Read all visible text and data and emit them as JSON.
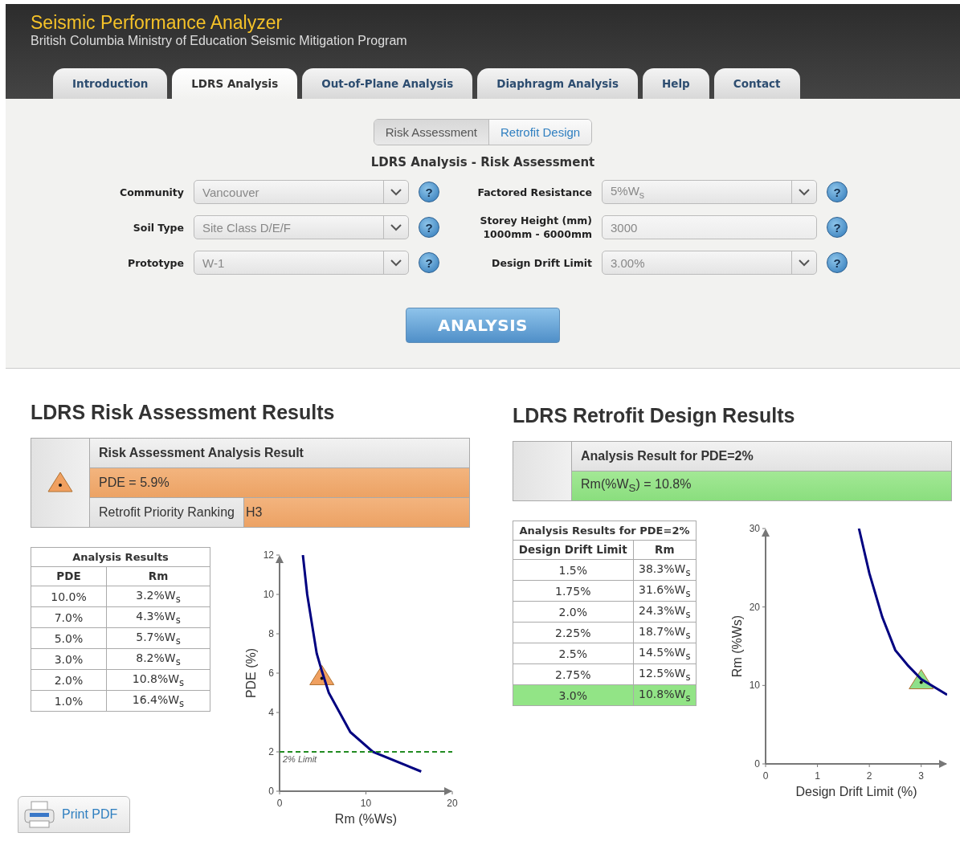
{
  "header": {
    "title": "Seismic Performance Analyzer",
    "subtitle": "British Columbia Ministry of Education Seismic Mitigation Program"
  },
  "tabs": [
    {
      "label": "Introduction",
      "selected": false
    },
    {
      "label": "LDRS Analysis",
      "selected": true
    },
    {
      "label": "Out-of-Plane Analysis",
      "selected": false
    },
    {
      "label": "Diaphragm Analysis",
      "selected": false
    },
    {
      "label": "Help",
      "selected": false
    },
    {
      "label": "Contact",
      "selected": false
    }
  ],
  "mode_toggle": [
    {
      "label": "Risk Assessment",
      "selected": true
    },
    {
      "label": "Retrofit Design",
      "selected": false
    }
  ],
  "form": {
    "title": "LDRS Analysis - Risk Assessment",
    "left_fields": [
      {
        "label": "Community",
        "kind": "select",
        "value": "Vancouver",
        "help": "?"
      },
      {
        "label": "Soil Type",
        "kind": "select",
        "value": "Site Class D/E/F",
        "help": "?"
      },
      {
        "label": "Prototype",
        "kind": "select",
        "value": "W-1",
        "help": "?"
      }
    ],
    "right_fields": [
      {
        "label": "Factored Resistance",
        "kind": "select",
        "value": "5%W$_{s}$",
        "help": "?"
      },
      {
        "label": "Storey Height (mm)",
        "hint": "1000mm - 6000mm",
        "kind": "input",
        "value": "3000",
        "help": "?"
      },
      {
        "label": "Design Drift Limit",
        "kind": "select",
        "value": "3.00%",
        "help": "?"
      }
    ],
    "submit": "ANALYSIS"
  },
  "risk_results": {
    "title": "LDRS Risk Assessment Results",
    "passed": false,
    "heading": "Risk Assessment Analysis Result",
    "result": "PDE = 5.9%",
    "ranking_label": "Retrofit Priority Ranking",
    "ranking_value": "H3",
    "table": {
      "caption": "Analysis Results",
      "columns": [
        "PDE",
        "Rm"
      ],
      "rows": [
        {
          "cells": [
            "10.0%",
            "3.2%W$_{s}$"
          ],
          "selected": false
        },
        {
          "cells": [
            "7.0%",
            "4.3%W$_{s}$"
          ],
          "selected": false
        },
        {
          "cells": [
            "5.0%",
            "5.7%W$_{s}$"
          ],
          "selected": false
        },
        {
          "cells": [
            "3.0%",
            "8.2%W$_{s}$"
          ],
          "selected": false
        },
        {
          "cells": [
            "2.0%",
            "10.8%W$_{s}$"
          ],
          "selected": false
        },
        {
          "cells": [
            "1.0%",
            "16.4%W$_{s}$"
          ],
          "selected": false
        }
      ]
    },
    "chart_data": {
      "type": "line",
      "xlabel": "Rm (%Ws)",
      "ylabel": "PDE (%)",
      "xlim": [
        0,
        20
      ],
      "ylim": [
        0,
        12
      ],
      "xticks": [
        0,
        10,
        20
      ],
      "yticks": [
        0,
        2,
        4,
        6,
        8,
        10,
        12
      ],
      "x": [
        0,
        2.7,
        3.2,
        4.3,
        4.9,
        5.7,
        8.2,
        10.8,
        16.4,
        20
      ],
      "series": [
        {
          "color": "#000080",
          "values": [
            null,
            12,
            10,
            7,
            6.1,
            5,
            3,
            2,
            1,
            null
          ]
        },
        {
          "color": "#f0a060",
          "marker": "triangle",
          "values": [
            null,
            null,
            null,
            null,
            5.9,
            null,
            null,
            null,
            null,
            null
          ]
        },
        {
          "name": "2% Limit",
          "color": "#228b22",
          "line_style": "dashed",
          "values": [
            2,
            null,
            null,
            null,
            null,
            null,
            null,
            null,
            null,
            2
          ]
        }
      ]
    }
  },
  "retrofit_results": {
    "title": "LDRS Retrofit Design Results",
    "passed": true,
    "heading": "Analysis Result for PDE=2%",
    "result": "Rm(%W$_{S}$) = 10.8%",
    "table": {
      "caption": "Analysis Results for PDE=2%",
      "columns": [
        "Design Drift Limit",
        "Rm"
      ],
      "rows": [
        {
          "cells": [
            "1.5%",
            "38.3%W$_{s}$"
          ],
          "selected": false
        },
        {
          "cells": [
            "1.75%",
            "31.6%W$_{s}$"
          ],
          "selected": false
        },
        {
          "cells": [
            "2.0%",
            "24.3%W$_{s}$"
          ],
          "selected": false
        },
        {
          "cells": [
            "2.25%",
            "18.7%W$_{s}$"
          ],
          "selected": false
        },
        {
          "cells": [
            "2.5%",
            "14.5%W$_{s}$"
          ],
          "selected": false
        },
        {
          "cells": [
            "2.75%",
            "12.5%W$_{s}$"
          ],
          "selected": false
        },
        {
          "cells": [
            "3.0%",
            "10.8%W$_{s}$"
          ],
          "selected": true
        }
      ]
    },
    "chart_data": {
      "type": "line",
      "xlabel": "Design Drift Limit (%)",
      "ylabel": "Rm (%Ws)",
      "xlim": [
        0,
        3.5
      ],
      "ylim": [
        0,
        30
      ],
      "xticks": [
        0,
        1,
        2,
        3
      ],
      "yticks": [
        0,
        10,
        20,
        30
      ],
      "x": [
        1.8,
        2.0,
        2.25,
        2.5,
        2.75,
        3.0,
        3.5
      ],
      "series": [
        {
          "color": "#000080",
          "values": [
            30,
            24.3,
            18.7,
            14.5,
            12.5,
            10.8,
            8.8
          ]
        },
        {
          "color": "#8fe08a",
          "marker": "triangle",
          "values": [
            null,
            null,
            null,
            null,
            null,
            10.8,
            null
          ]
        }
      ]
    }
  },
  "print_button": "Print PDF"
}
